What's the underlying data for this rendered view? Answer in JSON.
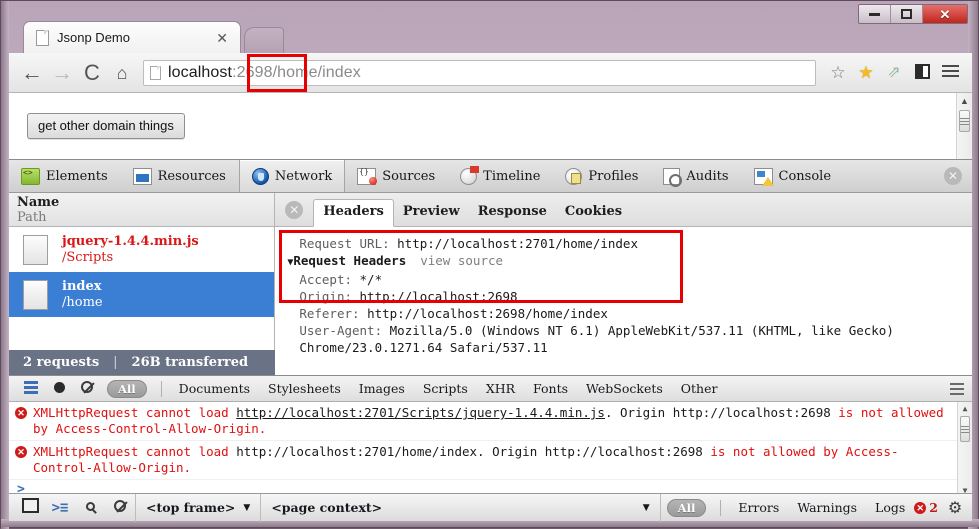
{
  "window": {
    "controls": {
      "minimize": "–",
      "maximize": "□",
      "close": "✕"
    }
  },
  "tabstrip": {
    "tab_title": "Jsonp Demo",
    "tab_close": "✕",
    "page_icon": "page-icon",
    "new_tab": "new-tab-button"
  },
  "toolbar": {
    "back": "←",
    "forward": "→",
    "reload": "C",
    "home": "⌂",
    "url_host": "localhost",
    "url_rest": ":2698/home/index",
    "url_full": "localhost:2698/home/index",
    "highlight_text": "2698/",
    "bookmark_outline": "☆",
    "bookmark_star": "★",
    "share": "⇗",
    "devtools_toggle": "devtools-icon",
    "menu": "menu-icon"
  },
  "page": {
    "button_label": "get other domain things"
  },
  "devtools": {
    "panels": [
      {
        "label": "Elements",
        "icon": "elements-icon",
        "active": false
      },
      {
        "label": "Resources",
        "icon": "resources-icon",
        "active": false
      },
      {
        "label": "Network",
        "icon": "network-icon",
        "active": true
      },
      {
        "label": "Sources",
        "icon": "sources-icon",
        "active": false
      },
      {
        "label": "Timeline",
        "icon": "timeline-icon",
        "active": false
      },
      {
        "label": "Profiles",
        "icon": "profiles-icon",
        "active": false
      },
      {
        "label": "Audits",
        "icon": "audits-icon",
        "active": false
      },
      {
        "label": "Console",
        "icon": "console-icon",
        "active": false
      }
    ],
    "close_label": "✕",
    "network": {
      "columns": {
        "name": "Name",
        "path": "Path"
      },
      "rows": [
        {
          "name": "jquery-1.4.4.min.js",
          "path": "/Scripts",
          "state": "error"
        },
        {
          "name": "index",
          "path": "/home",
          "state": "selected"
        }
      ],
      "summary": {
        "requests": "2 requests",
        "separator": "|",
        "transferred": "26B transferred"
      }
    },
    "detail": {
      "close_label": "✕",
      "tabs": [
        {
          "label": "Headers",
          "active": true
        },
        {
          "label": "Preview",
          "active": false
        },
        {
          "label": "Response",
          "active": false
        },
        {
          "label": "Cookies",
          "active": false
        }
      ],
      "request_url_label": "Request URL:",
      "request_url_value": "http://localhost:2701/home/index",
      "request_headers_label": "Request Headers",
      "request_headers_triangle": "▼",
      "view_source": "view source",
      "headers": [
        {
          "key": "Accept:",
          "value": "*/*"
        },
        {
          "key": "Origin:",
          "value": "http://localhost:2698"
        },
        {
          "key": "Referer:",
          "value": "http://localhost:2698/home/index"
        }
      ],
      "user_agent_label": "User-Agent:",
      "user_agent_value": "Mozilla/5.0 (Windows NT 6.1) AppleWebKit/537.11 (KHTML, like Gecko) Chrome/23.0.1271.64 Safari/537.11"
    },
    "filterbar": {
      "list_icon": "list-view-icon",
      "record_icon": "record-icon",
      "clear_icon": "clear-icon",
      "all_pill": "All",
      "types": [
        "Documents",
        "Stylesheets",
        "Images",
        "Scripts",
        "XHR",
        "Fonts",
        "WebSockets",
        "Other"
      ],
      "options_icon": "options-icon"
    },
    "console": {
      "messages": [
        {
          "badge": "✕",
          "prefix": "XMLHttpRequest cannot load ",
          "link": "http://localhost:2701/Scripts/jquery-1.4.4.min.js",
          "mid": ". Origin ",
          "origin": "http://localhost:2698",
          "suffix": " is not allowed by Access-Control-Allow-Origin.",
          "link_underlined": true
        },
        {
          "badge": "✕",
          "prefix": "XMLHttpRequest cannot load ",
          "link": "http://localhost:2701/home/index",
          "mid": ". Origin ",
          "origin": "http://localhost:2698",
          "suffix": " is not allowed by Access-Control-Allow-Origin.",
          "link_underlined": false
        }
      ],
      "prompt": ">"
    },
    "statusbar": {
      "dock_icon": "dock-icon",
      "console_icon": "show-console-icon",
      "search_icon": "search-icon",
      "clear_icon": "clear-console-icon",
      "frame_selector": "<top frame>",
      "frame_caret": "▼",
      "context_selector": "<page context>",
      "context_caret": "▼",
      "all_pill": "All",
      "levels": [
        "Errors",
        "Warnings",
        "Logs"
      ],
      "error_count": "2",
      "error_badge": "✕",
      "gear_icon": "gear-icon"
    }
  },
  "colors": {
    "highlight_box": "#e60000",
    "error_text": "#e01010",
    "selected_row": "#3b7fd4",
    "summary_bar": "#6a7285"
  }
}
